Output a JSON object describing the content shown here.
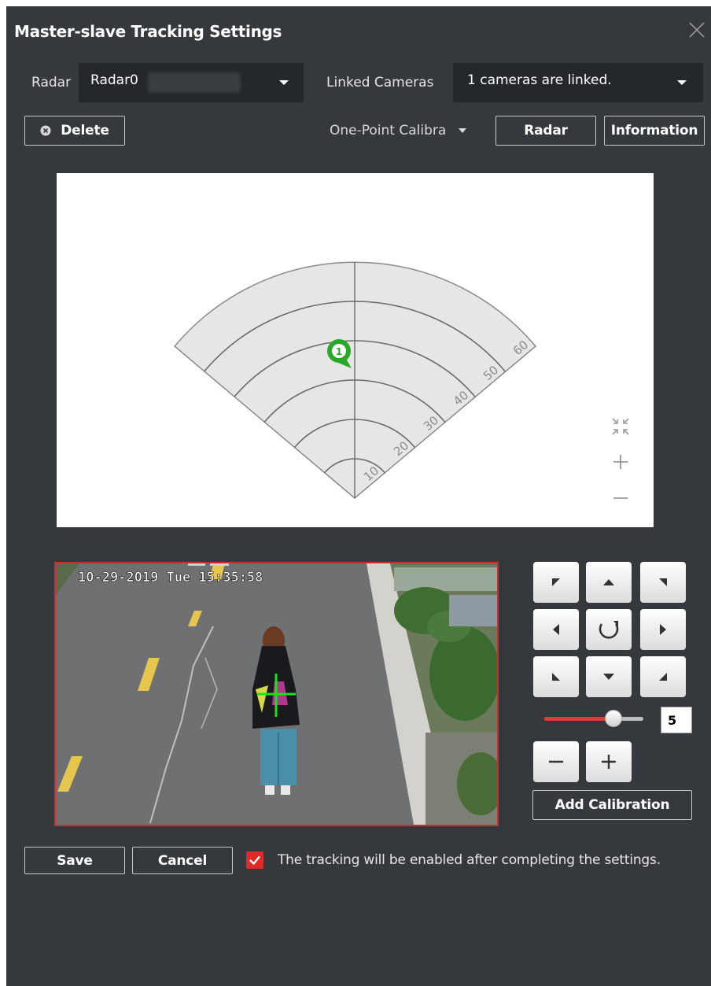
{
  "dialog": {
    "title": "Master-slave Tracking Settings"
  },
  "toolbar": {
    "radar_label": "Radar",
    "radar_value": "Radar0",
    "linked_label": "Linked Cameras",
    "linked_value": "1 cameras are linked.",
    "delete_label": "Delete",
    "calibration_mode": "One-Point Calibra",
    "radar_button": "Radar",
    "information_button": "Information"
  },
  "radar_map": {
    "range_labels": [
      "10",
      "20",
      "30",
      "40",
      "50",
      "60"
    ],
    "target_id": "1",
    "zoom_controls": [
      "fit-icon",
      "zoom-in-icon",
      "zoom-out-icon"
    ]
  },
  "camera": {
    "osd_timestamp": "10-29-2019 Tue 15:35:58",
    "border_color": "#d32a2a",
    "crosshair_color": "#1ee01e"
  },
  "ptz": {
    "speed_value": "5",
    "speed_fraction": 0.7,
    "add_calibration_label": "Add Calibration"
  },
  "footer": {
    "save_label": "Save",
    "cancel_label": "Cancel",
    "tracking_checked": true,
    "tracking_note": "The tracking will be enabled after completing the settings."
  },
  "colors": {
    "dialog_bg": "#35383d",
    "select_bg": "#24272b",
    "accent": "#e02a2a",
    "target": "#2aa82a"
  }
}
